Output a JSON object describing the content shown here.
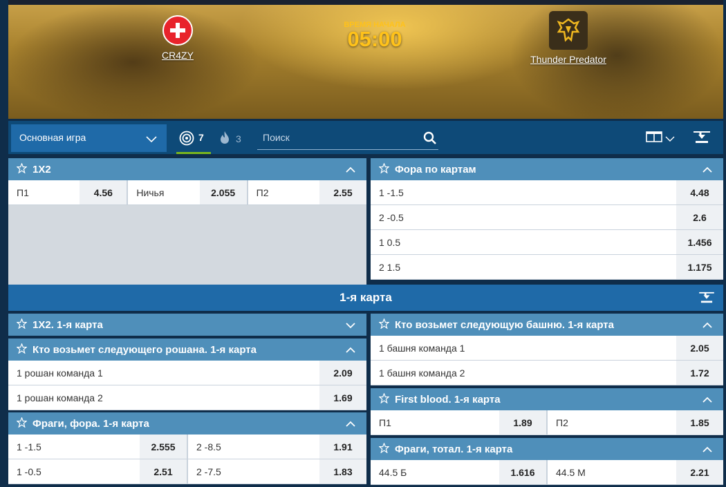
{
  "match": {
    "team1": "CR4ZY",
    "team2": "Thunder Predator",
    "start_label": "ВРЕМЯ НАЧАЛА",
    "start_time": "05:00"
  },
  "toolbar": {
    "game_select": "Основная игра",
    "live_count": "7",
    "hot_count": "3",
    "search_placeholder": "Поиск"
  },
  "colors": {
    "accent": "#1f6aa8",
    "header": "#4f8fba",
    "gold": "#ffc21a",
    "active_tab": "#7ab61e"
  },
  "markets": {
    "onextwo": {
      "title": "1X2",
      "p1": "П1",
      "p1_odd": "4.56",
      "draw": "Ничья",
      "draw_odd": "2.055",
      "p2": "П2",
      "p2_odd": "2.55"
    },
    "map_handicap": {
      "title": "Фора по картам",
      "rows": [
        {
          "name": "1 -1.5",
          "odd": "4.48"
        },
        {
          "name": "2 -0.5",
          "odd": "2.6"
        },
        {
          "name": "1 0.5",
          "odd": "1.456"
        },
        {
          "name": "2 1.5",
          "odd": "1.175"
        }
      ]
    },
    "section_title": "1-я карта",
    "onextwo_map1": {
      "title": "1X2. 1-я карта"
    },
    "roshan": {
      "title": "Кто возьмет следующего рошана. 1-я карта",
      "rows": [
        {
          "name": "1 рошан команда 1",
          "odd": "2.09"
        },
        {
          "name": "1 рошан команда 2",
          "odd": "1.69"
        }
      ]
    },
    "frags_handicap": {
      "title": "Фраги, фора. 1-я карта",
      "rows": [
        {
          "a": "1 -1.5",
          "a_odd": "2.555",
          "b": "2 -8.5",
          "b_odd": "1.91"
        },
        {
          "a": "1 -0.5",
          "a_odd": "2.51",
          "b": "2 -7.5",
          "b_odd": "1.83"
        }
      ]
    },
    "tower": {
      "title": "Кто возьмет следующую башню. 1-я карта",
      "rows": [
        {
          "name": "1 башня команда 1",
          "odd": "2.05"
        },
        {
          "name": "1 башня команда 2",
          "odd": "1.72"
        }
      ]
    },
    "first_blood": {
      "title": "First blood. 1-я карта",
      "p1": "П1",
      "p1_odd": "1.89",
      "p2": "П2",
      "p2_odd": "1.85"
    },
    "frags_total": {
      "title": "Фраги, тотал. 1-я карта",
      "over": "44.5 Б",
      "over_odd": "1.616",
      "under": "44.5 М",
      "under_odd": "2.21"
    }
  }
}
